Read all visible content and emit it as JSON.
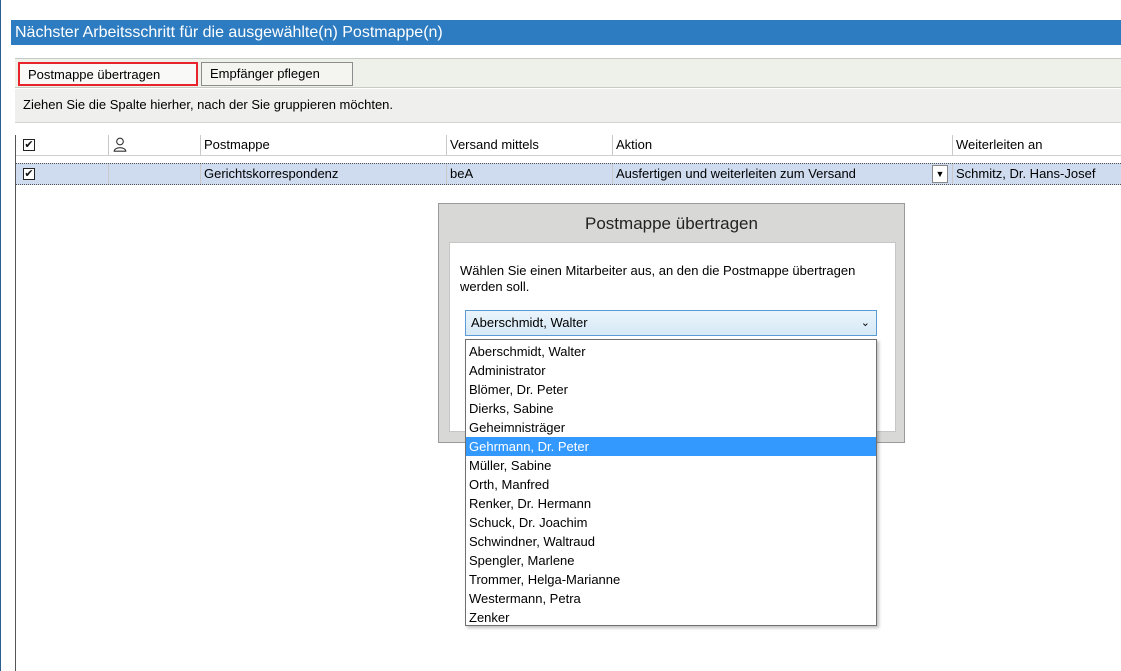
{
  "window": {
    "title": "Nächster Arbeitsschritt für die ausgewählte(n) Postmappe(n)"
  },
  "tabs": [
    {
      "label": "Postmappe übertragen",
      "active": true
    },
    {
      "label": "Empfänger pflegen",
      "active": false
    }
  ],
  "group_hint": "Ziehen Sie die Spalte hierher, nach der Sie gruppieren möchten.",
  "grid": {
    "headers": {
      "checkbox_icon": "checkbox-checked-icon",
      "person_icon": "person-icon",
      "postmappe": "Postmappe",
      "versand": "Versand mittels",
      "aktion": "Aktion",
      "weiterleiten": "Weiterleiten an"
    },
    "rows": [
      {
        "checked": true,
        "postmappe": "Gerichtskorrespondenz",
        "versand": "beA",
        "aktion": "Ausfertigen und weiterleiten zum Versand",
        "weiterleiten": "Schmitz, Dr. Hans-Josef"
      }
    ]
  },
  "dialog": {
    "title": "Postmappe übertragen",
    "prompt": "Wählen Sie einen Mitarbeiter aus, an den die Postmappe übertragen werden soll.",
    "selected_value": "Aberschmidt, Walter",
    "options": [
      "Aberschmidt, Walter",
      "Administrator",
      "Blömer, Dr. Peter",
      "Dierks, Sabine",
      "Geheimnisträger",
      "Gehrmann, Dr. Peter",
      "Müller, Sabine",
      "Orth, Manfred",
      "Renker, Dr. Hermann",
      "Schuck, Dr. Joachim",
      "Schwindner, Waltraud",
      "Spengler, Marlene",
      "Trommer, Helga-Marianne",
      "Westermann, Petra",
      "Zenker"
    ],
    "highlighted_option": "Gehrmann, Dr. Peter"
  },
  "colors": {
    "titlebar": "#2d7cc1",
    "active_tab_border": "#e8232b",
    "selection": "#3399ff",
    "row_highlight": "#cfdcef"
  }
}
